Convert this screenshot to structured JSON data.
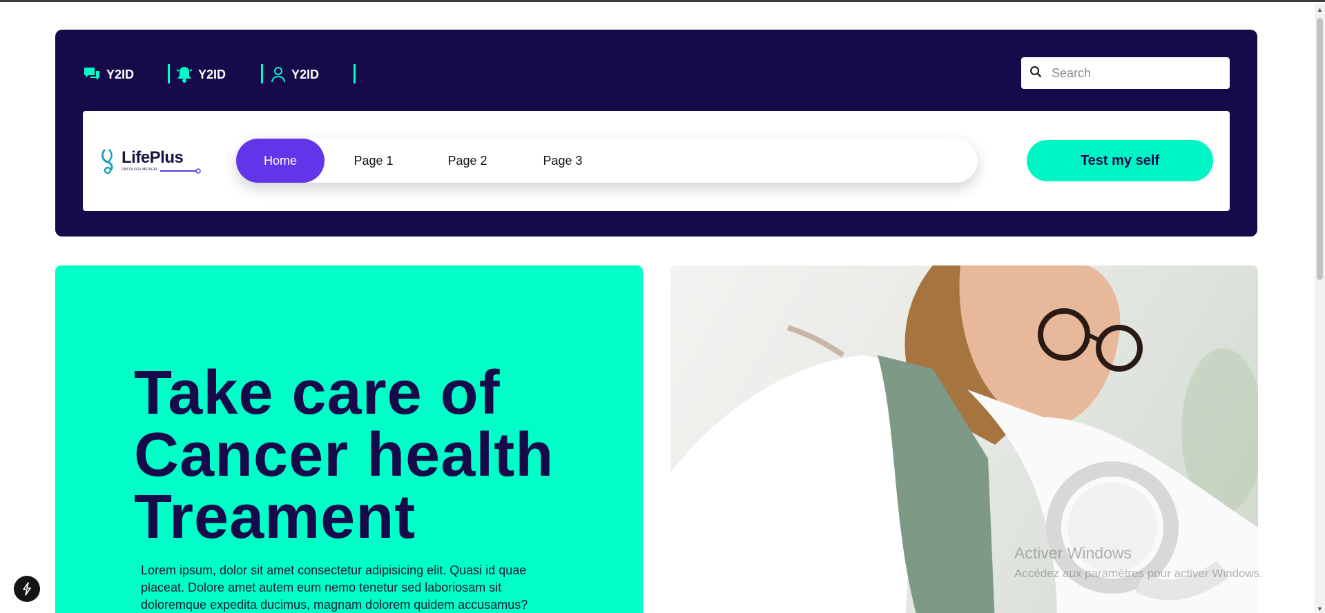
{
  "topbar": {
    "items": [
      {
        "label": "Y2ID",
        "icon": "messages-icon"
      },
      {
        "label": "Y2ID",
        "icon": "bell-icon"
      },
      {
        "label": "Y2ID",
        "icon": "user-icon"
      }
    ],
    "search_placeholder": "Search"
  },
  "logo": {
    "name": "LifePlus",
    "tagline": "ONCOLOGY MEDICAL"
  },
  "nav": {
    "items": [
      {
        "label": "Home",
        "active": true
      },
      {
        "label": "Page 1",
        "active": false
      },
      {
        "label": "Page 2",
        "active": false
      },
      {
        "label": "Page 3",
        "active": false
      }
    ],
    "cta_label": "Test my self"
  },
  "hero": {
    "title_lines": [
      "Take care of",
      "Cancer health",
      "Treament"
    ],
    "text": "Lorem ipsum, dolor sit amet consectetur adipisicing elit. Quasi id quae placeat. Dolore amet autem eum nemo tenetur sed laboriosam sit doloremque expedita ducimus, magnam dolorem quidem accusamus?"
  },
  "watermark": {
    "line1": "Activer Windows",
    "line2": "Accédez aux paramètres pour activer Windows."
  },
  "colors": {
    "header_bg": "#160a4a",
    "accent": "#00ffc8",
    "nav_active": "#6236e8"
  }
}
